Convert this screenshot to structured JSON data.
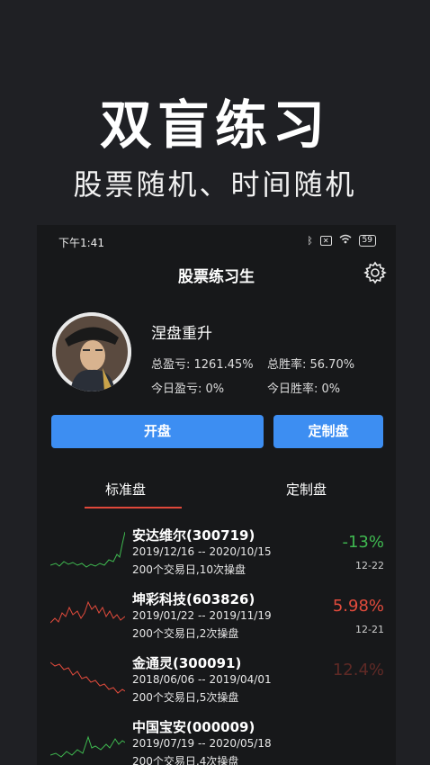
{
  "promo": {
    "title": "双盲练习",
    "subtitle": "股票随机、时间随机"
  },
  "status_bar": {
    "time": "下午1:41",
    "battery": "59",
    "icons": [
      "bluetooth-icon",
      "no-sim-icon",
      "wifi-icon",
      "battery-icon"
    ]
  },
  "app": {
    "title": "股票练习生",
    "settings_icon": "gear-icon"
  },
  "profile": {
    "username": "涅盘重升",
    "total_pnl": "总盈亏: 1261.45%",
    "total_win_rate": "总胜率: 56.70%",
    "today_pnl": "今日盈亏: 0%",
    "today_win_rate": "今日胜率: 0%"
  },
  "buttons": {
    "open": "开盘",
    "custom": "定制盘"
  },
  "tabs": [
    {
      "label": "标准盘",
      "active": true
    },
    {
      "label": "定制盘",
      "active": false
    }
  ],
  "colors": {
    "accent": "#3d8ef2",
    "gain": "#e24b3c",
    "loss": "#3fb950",
    "tab_underline": "#e0483a"
  },
  "stocks": [
    {
      "name": "安达维尔(300719)",
      "period": "2019/12/16 -- 2020/10/15",
      "info": "200个交易日,10次操盘",
      "change": "-13%",
      "date": "12-22",
      "trend": "loss"
    },
    {
      "name": "坤彩科技(603826)",
      "period": "2019/01/22 -- 2019/11/19",
      "info": "200个交易日,2次操盘",
      "change": "5.98%",
      "date": "12-21",
      "trend": "gain"
    },
    {
      "name": "金通灵(300091)",
      "period": "2018/06/06 -- 2019/04/01",
      "info": "200个交易日,5次操盘",
      "change": "12.4%",
      "date": "",
      "trend": "gain"
    },
    {
      "name": "中国宝安(000009)",
      "period": "2019/07/19 -- 2020/05/18",
      "info": "200个交易日,4次操盘",
      "change": "",
      "date": "",
      "trend": "loss"
    }
  ]
}
